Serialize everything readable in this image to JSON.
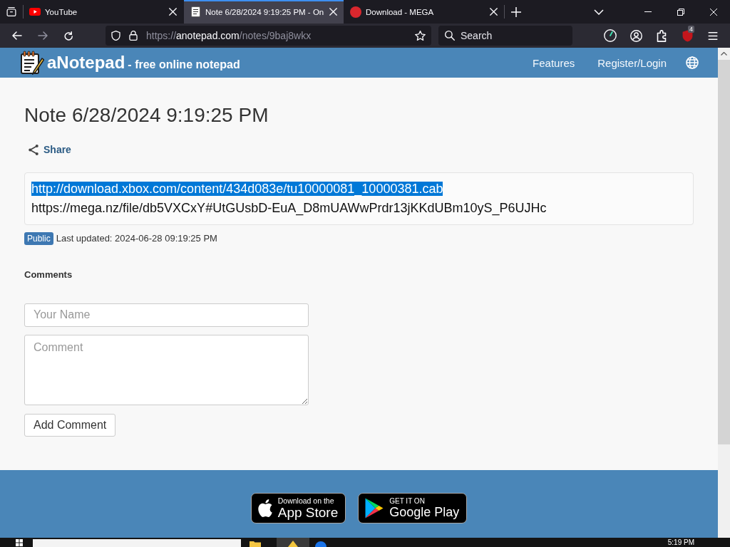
{
  "browser": {
    "tabs": [
      {
        "kind": "play",
        "title": "YouTube",
        "selected": false
      },
      {
        "kind": "notepad",
        "title": "Note 6/28/2024 9:19:25 PM - On",
        "selected": true
      },
      {
        "kind": "circle",
        "title": "Download - MEGA",
        "selected": false
      }
    ],
    "nav_buttons": [
      {
        "kind": "back",
        "disabled": false
      },
      {
        "kind": "forward",
        "disabled": true
      },
      {
        "kind": "reload",
        "disabled": false
      }
    ],
    "address": {
      "scheme": "https://",
      "domain": "anotepad.com",
      "path": "/notes/9baj8wkx"
    },
    "search": {
      "placeholder": "Search"
    },
    "extension_badge": "4"
  },
  "site_header": {
    "name": "aNotepad",
    "tagline": "- free online notepad",
    "links": [
      "Features",
      "Register/Login"
    ]
  },
  "note": {
    "title": "Note 6/28/2024 9:19:25 PM",
    "share": "Share",
    "lines": [
      {
        "text": "http://download.xbox.com/content/434d083e/tu10000081_10000381.cab",
        "selected": true
      },
      {
        "text": "https://mega.nz/file/db5VXCxY#UtGUsbD-EuA_D8mUAWwPrdr13jKKdUBm10yS_P6UJHc",
        "selected": false
      }
    ],
    "visibility": "Public",
    "last_updated": "Last updated: 2024-06-28 09:19:25 PM"
  },
  "comments": {
    "heading": "Comments",
    "name_field": {
      "placeholder": "Your Name"
    },
    "comment_field": {
      "placeholder": "Comment"
    },
    "submit": "Add Comment"
  },
  "footer": {
    "store_badges": [
      {
        "kind": "apple",
        "caption": "Download on the",
        "store": "App Store"
      },
      {
        "kind": "play",
        "caption": "GET IT ON",
        "store": "Google Play"
      }
    ]
  },
  "taskbar": {
    "clock": "5:19 PM"
  }
}
